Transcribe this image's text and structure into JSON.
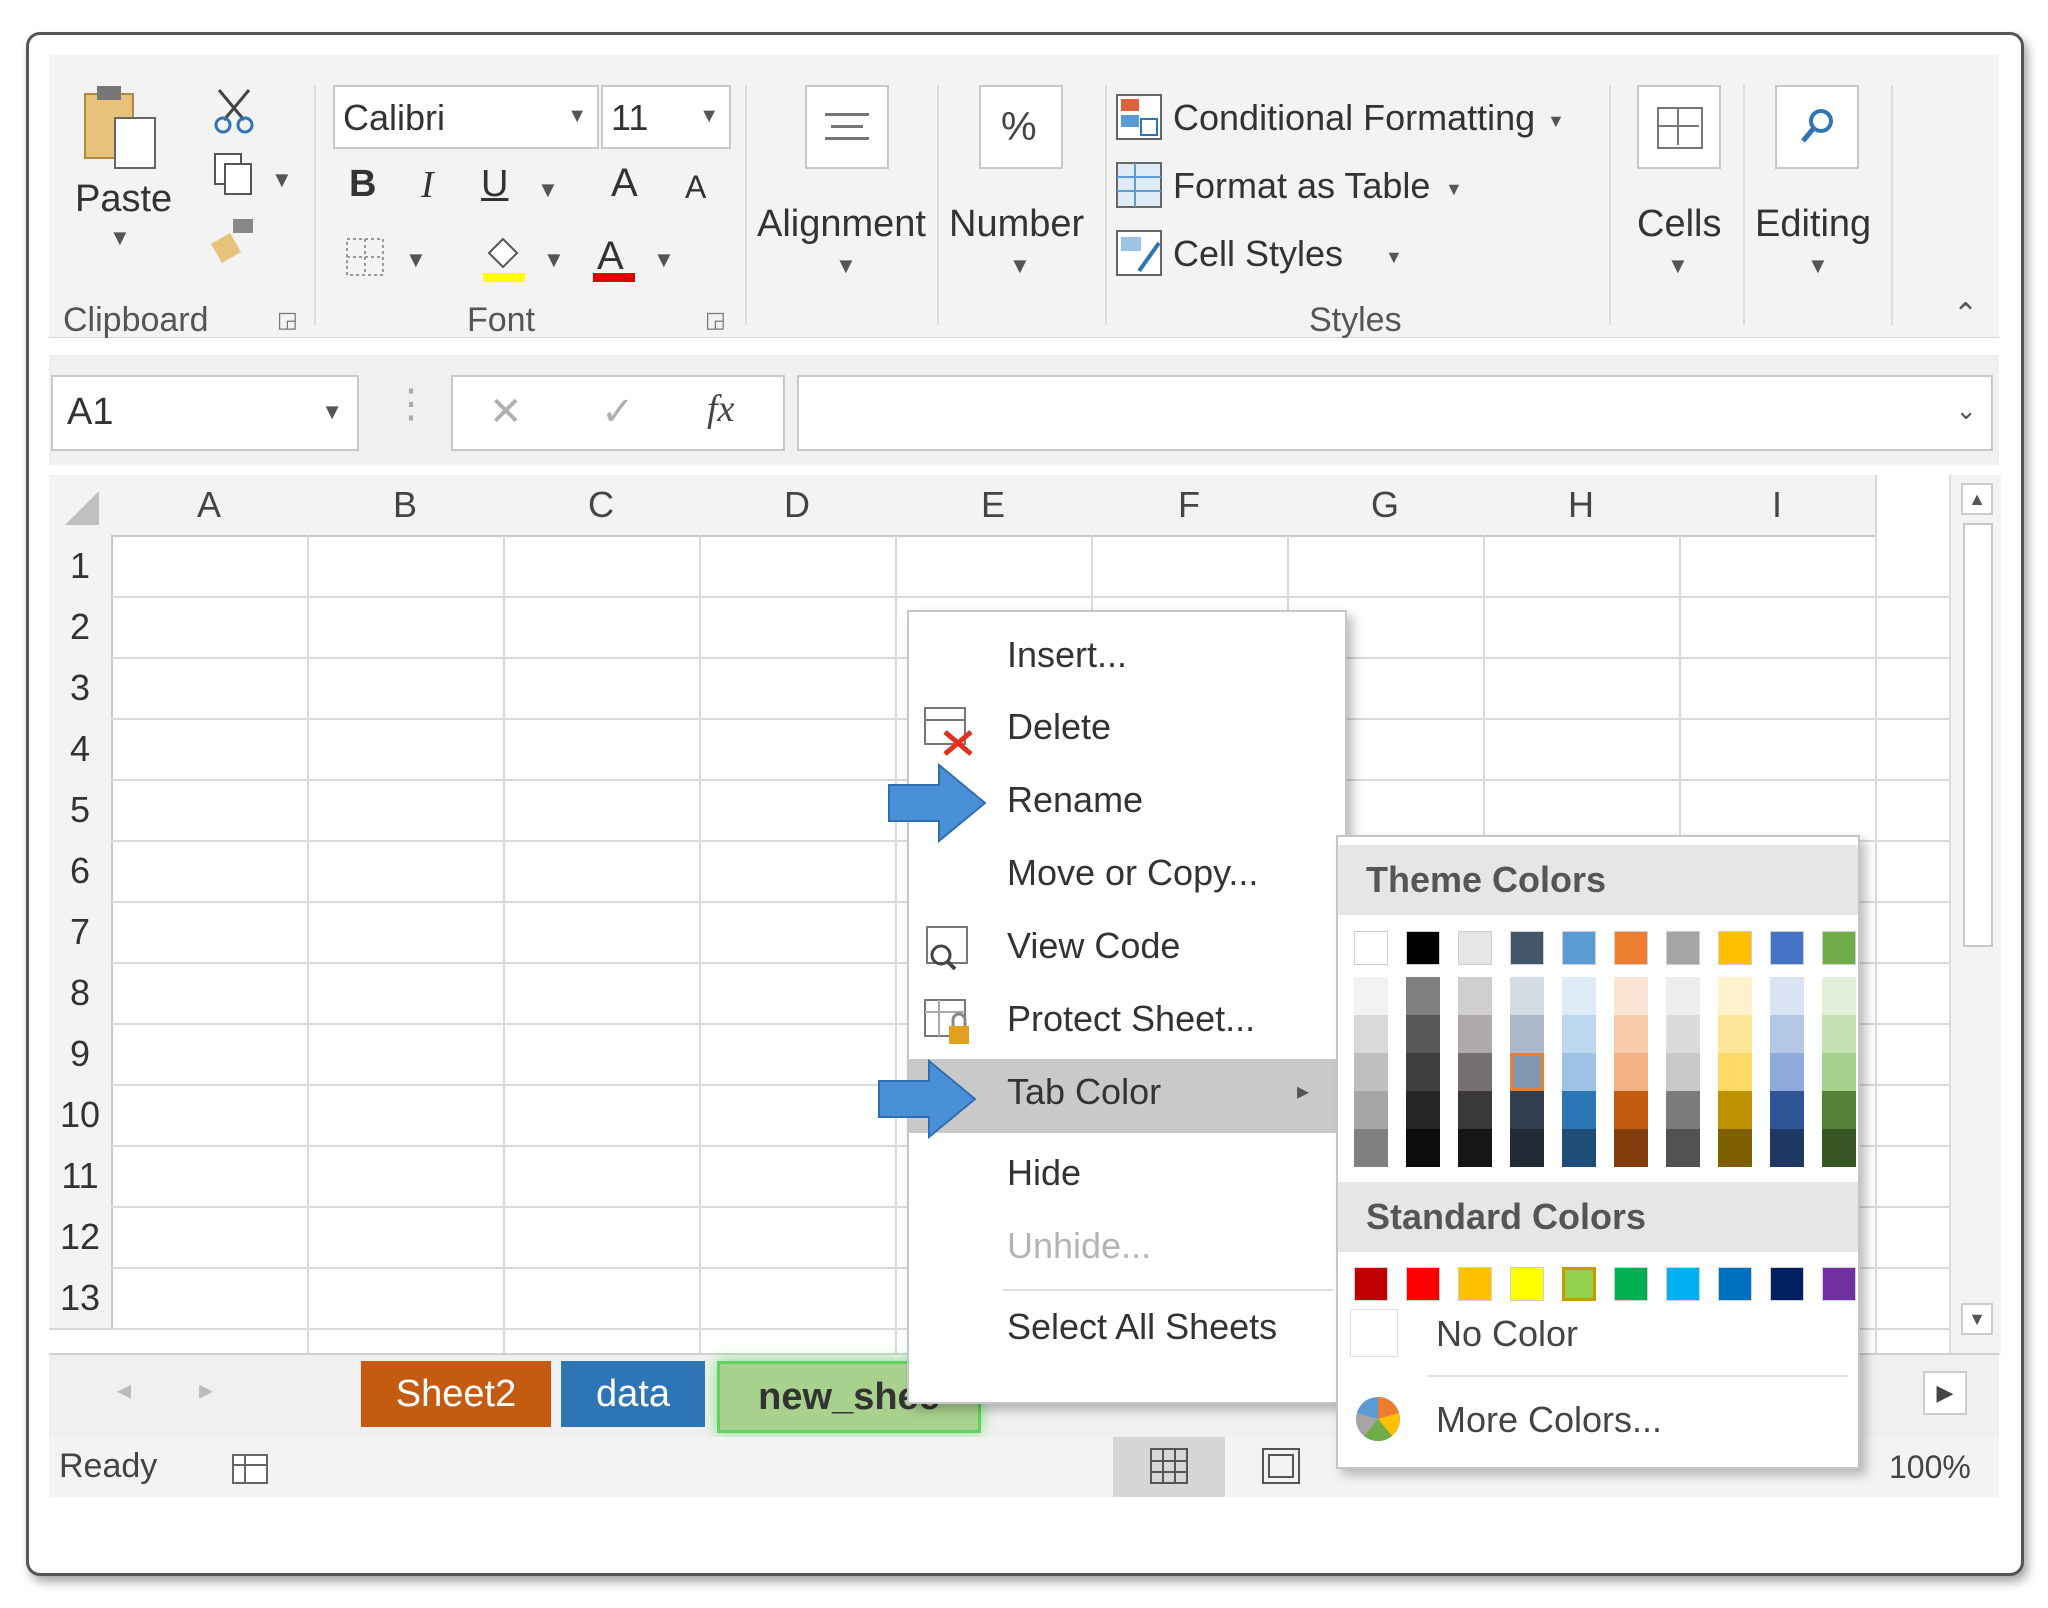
{
  "ribbon": {
    "paste_label": "Paste",
    "clipboard_label": "Clipboard",
    "font_name": "Calibri",
    "font_size": "11",
    "bold": "B",
    "italic": "I",
    "underline": "U",
    "grow_font": "A",
    "shrink_font": "A",
    "font_label": "Font",
    "alignment_label": "Alignment",
    "number_symbol": "%",
    "number_label": "Number",
    "conditional_formatting": "Conditional Formatting",
    "format_as_table": "Format as Table",
    "cell_styles": "Cell Styles",
    "styles_label": "Styles",
    "cells_label": "Cells",
    "editing_label": "Editing"
  },
  "formula_bar": {
    "name_box": "A1",
    "cancel_glyph": "✕",
    "enter_glyph": "✓",
    "fx_glyph": "fx",
    "value": ""
  },
  "grid": {
    "columns": [
      "A",
      "B",
      "C",
      "D",
      "E",
      "F",
      "G",
      "H",
      "I"
    ],
    "rows": [
      "1",
      "2",
      "3",
      "4",
      "5",
      "6",
      "7",
      "8",
      "9",
      "10",
      "11",
      "12",
      "13"
    ]
  },
  "sheet_tabs": [
    {
      "label": "Sheet2",
      "color": "#c55a11"
    },
    {
      "label": "data",
      "color": "#2e75b6"
    },
    {
      "label": "new_shee",
      "color": "#a9d18e"
    }
  ],
  "status": {
    "ready": "Ready",
    "zoom": "100%"
  },
  "context_menu": {
    "items": [
      {
        "label": "Insert..."
      },
      {
        "label": "Delete"
      },
      {
        "label": "Rename"
      },
      {
        "label": "Move or Copy..."
      },
      {
        "label": "View Code"
      },
      {
        "label": "Protect Sheet..."
      },
      {
        "label": "Tab Color"
      },
      {
        "label": "Hide"
      },
      {
        "label": "Unhide..."
      },
      {
        "label": "Select All Sheets"
      }
    ]
  },
  "palette": {
    "theme_title": "Theme Colors",
    "standard_title": "Standard Colors",
    "no_color": "No Color",
    "more_colors": "More Colors...",
    "theme_colors": [
      "#ffffff",
      "#000000",
      "#e7e6e6",
      "#44546a",
      "#5b9bd5",
      "#ed7d31",
      "#a5a5a5",
      "#ffc000",
      "#4472c4",
      "#70ad47"
    ],
    "theme_shades": [
      [
        "#f2f2f2",
        "#d9d9d9",
        "#bfbfbf",
        "#a6a6a6",
        "#808080"
      ],
      [
        "#808080",
        "#595959",
        "#404040",
        "#262626",
        "#0d0d0d"
      ],
      [
        "#d0cece",
        "#aeaaaa",
        "#767171",
        "#3a3838",
        "#171616"
      ],
      [
        "#d6dce4",
        "#adb9ca",
        "#8497b0",
        "#333f4f",
        "#222a35"
      ],
      [
        "#deebf6",
        "#bdd7ee",
        "#9dc3e6",
        "#2e75b5",
        "#1f4e79"
      ],
      [
        "#fbe5d5",
        "#f7cbac",
        "#f4b183",
        "#c55a11",
        "#833c0b"
      ],
      [
        "#ededed",
        "#dbdbdb",
        "#c9c9c9",
        "#7b7b7b",
        "#525252"
      ],
      [
        "#fff2cc",
        "#fee599",
        "#ffd965",
        "#bf9000",
        "#7f6000"
      ],
      [
        "#dae3f3",
        "#b4c7e7",
        "#8faadc",
        "#2f5597",
        "#1f3864"
      ],
      [
        "#e2efd9",
        "#c5e0b3",
        "#a8d08d",
        "#538135",
        "#375623"
      ]
    ],
    "standard_colors": [
      "#c00000",
      "#ff0000",
      "#ffc000",
      "#ffff00",
      "#92d050",
      "#00b050",
      "#00b0f0",
      "#0070c0",
      "#002060",
      "#7030a0"
    ]
  }
}
